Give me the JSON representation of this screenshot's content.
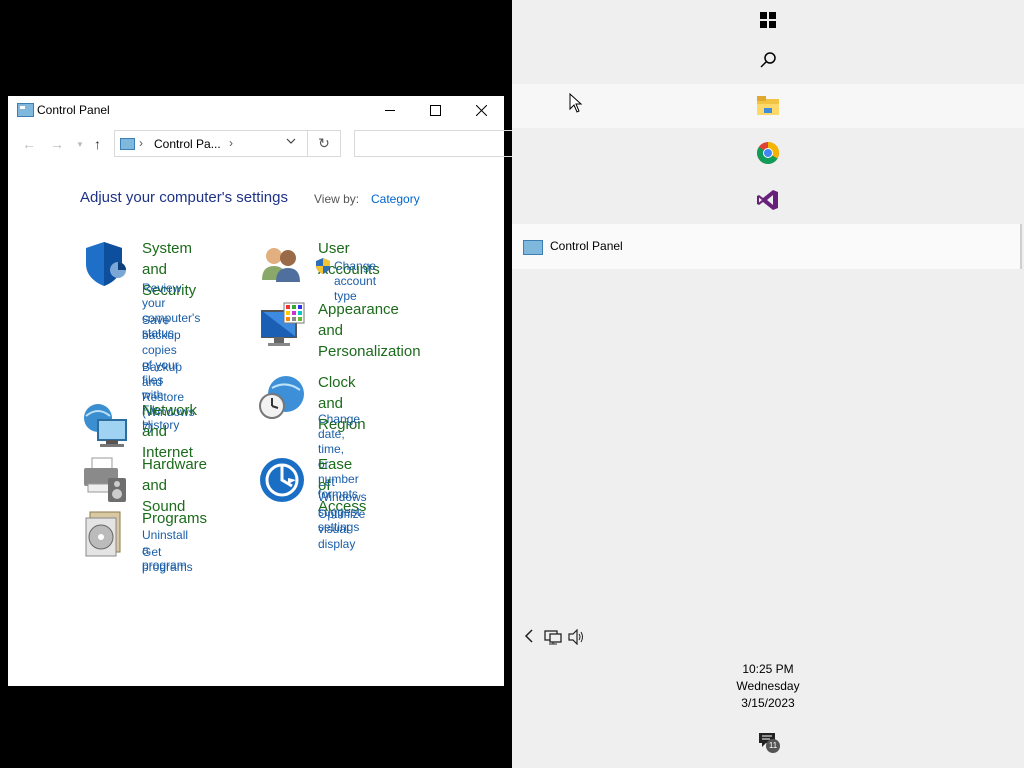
{
  "window": {
    "title": "Control Panel",
    "address_path": "Control Pa...",
    "search_placeholder": ""
  },
  "main": {
    "heading": "Adjust your computer's settings",
    "view_by_label": "View by:",
    "view_by_value": "Category"
  },
  "categories": {
    "system_security": {
      "name1": "System and",
      "name2": "Security",
      "link1a": "Review your",
      "link1b": "computer's status",
      "link2a": "Save backup copies",
      "link2b": "of your files with",
      "link2c": "File History",
      "link3a": "Backup and Restore",
      "link3b": "(Windows 7)"
    },
    "network": {
      "name1": "Network and",
      "name2": "Internet"
    },
    "hardware": {
      "name1": "Hardware and",
      "name2": "Sound"
    },
    "programs": {
      "name1": "Programs",
      "link1": "Uninstall a program",
      "link2": "Get programs"
    },
    "user_accounts": {
      "name1": "User Accounts",
      "link1a": "Change account",
      "link1b": "type"
    },
    "appearance": {
      "name1": "Appearance",
      "name2": "and",
      "name3": "Personalization"
    },
    "clock": {
      "name1": "Clock and",
      "name2": "Region",
      "link1a": "Change date, time,",
      "link1b": "or number formats"
    },
    "ease": {
      "name1": "Ease of Access",
      "link1a": "Let Windows",
      "link1b": "suggest settings",
      "link2a": "Optimize visual",
      "link2b": "display"
    }
  },
  "taskbar": {
    "open_item_label": "Control Panel",
    "pinned_icons": [
      "windows-start-icon",
      "search-icon",
      "file-explorer-icon",
      "chrome-icon",
      "visual-studio-icon"
    ],
    "clock": {
      "time": "10:25 PM",
      "day": "Wednesday",
      "date": "3/15/2023"
    },
    "notification_count": "11"
  }
}
